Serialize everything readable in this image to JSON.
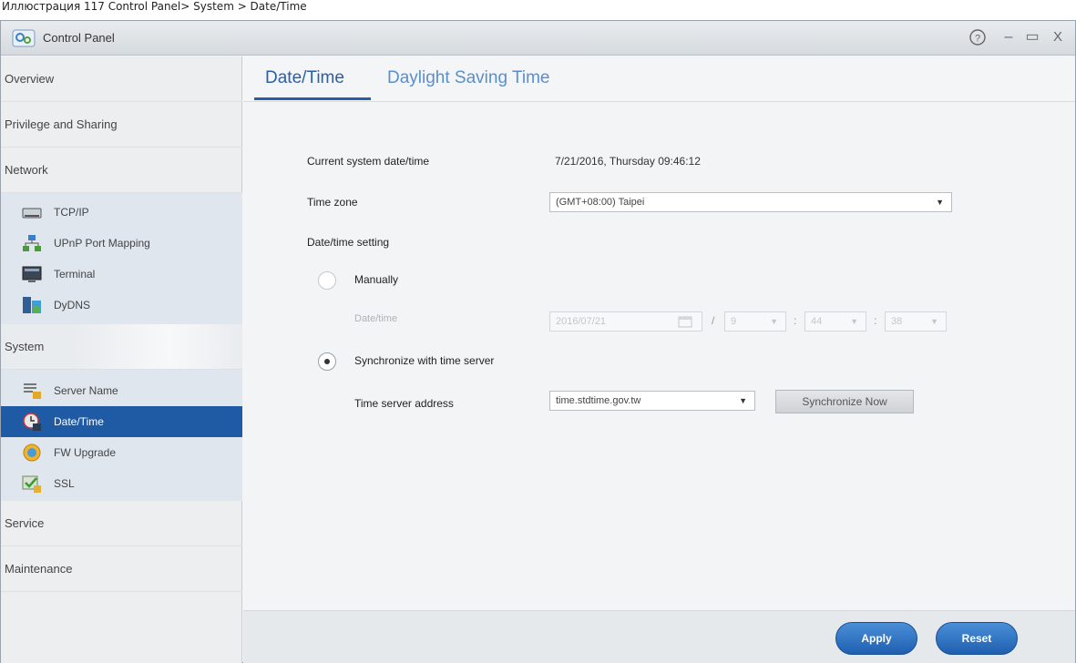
{
  "caption": "Иллюстрация 117 Control Panel> System > Date/Time",
  "window": {
    "title": "Control Panel",
    "help": "?",
    "minimize": "–",
    "maximize": "▭",
    "close": "X"
  },
  "sidebar": {
    "categories": [
      "Overview",
      "Privilege and Sharing",
      "Network",
      "System",
      "Service",
      "Maintenance"
    ],
    "network_items": [
      "TCP/IP",
      "UPnP Port Mapping",
      "Terminal",
      "DyDNS"
    ],
    "system_items": [
      "Server Name",
      "Date/Time",
      "FW Upgrade",
      "SSL"
    ],
    "active_item": "Date/Time"
  },
  "tabs": [
    "Date/Time",
    "Daylight Saving Time"
  ],
  "form": {
    "current_label": "Current system date/time",
    "current_value": "7/21/2016, Thursday 09:46:12",
    "timezone_label": "Time zone",
    "timezone_value": "(GMT+08:00) Taipei",
    "setting_label": "Date/time setting",
    "manual_label": "Manually",
    "manual_datetime_label": "Date/time",
    "manual_date_value": "2016/07/21",
    "manual_hour": "9",
    "manual_minute": "44",
    "manual_second": "38",
    "sync_label": "Synchronize with time server",
    "server_label": "Time server address",
    "server_value": "time.stdtime.gov.tw",
    "sync_now": "Synchronize Now",
    "sep_slash": "/",
    "sep_colon": ":"
  },
  "footer": {
    "apply": "Apply",
    "reset": "Reset"
  }
}
